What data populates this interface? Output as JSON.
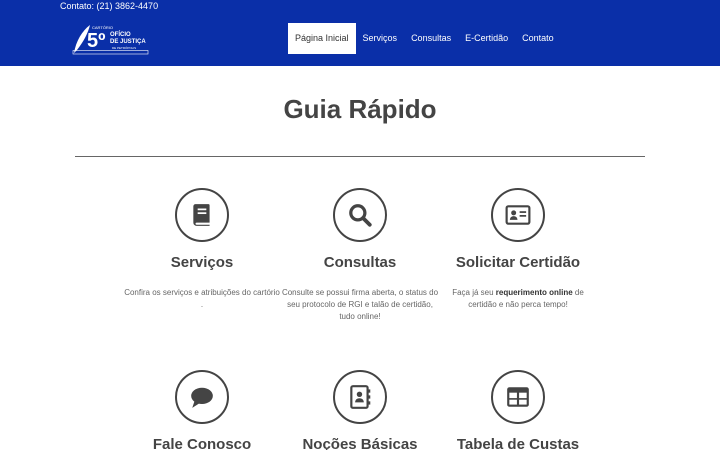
{
  "header": {
    "contact": "Contato: (21) 3862-4470",
    "logo": {
      "line1": "CARTÓRIO",
      "number": "5º",
      "line2": "OFÍCIO",
      "line3": "DE JUSTIÇA",
      "line4": "DE PETRÓPOLIS"
    },
    "nav": [
      {
        "label": "Página Inicial",
        "active": true
      },
      {
        "label": "Serviços"
      },
      {
        "label": "Consultas"
      },
      {
        "label": "E-Certidão"
      },
      {
        "label": "Contato"
      }
    ]
  },
  "main": {
    "title": "Guia Rápido",
    "cards": [
      {
        "title": "Serviços",
        "icon": "book-icon",
        "desc": "Confira os serviços e atribuições do cartório ."
      },
      {
        "title": "Consultas",
        "icon": "search-icon",
        "desc": "Consulte se possui firma aberta, o status do seu protocolo de RGI e talão de certidão, tudo online!"
      },
      {
        "title": "Solicitar Certidão",
        "icon": "id-card-icon",
        "desc_pre": "Faça já seu ",
        "desc_bold": "requerimento online",
        "desc_post": " de certidão e não perca tempo!"
      },
      {
        "title": "Fale Conosco",
        "icon": "chat-bubble-icon"
      },
      {
        "title": "Noções Básicas",
        "icon": "address-book-icon"
      },
      {
        "title": "Tabela de Custas",
        "icon": "table-icon"
      }
    ]
  },
  "colors": {
    "header_bg": "#0a2fa8",
    "text": "#444444"
  }
}
